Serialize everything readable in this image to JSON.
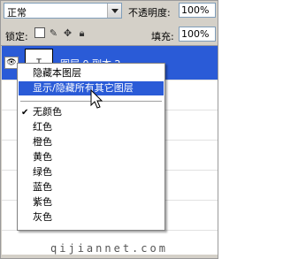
{
  "toolbar": {
    "blend_mode": "正常",
    "opacity_label": "不透明度:",
    "opacity_value": "100%",
    "lock_label": "锁定:",
    "fill_label": "填充:",
    "fill_value": "100%"
  },
  "layer": {
    "name": "图层 0 副本 2",
    "thumb_label": "T"
  },
  "menu": {
    "items": [
      {
        "label": "隐藏本图层"
      },
      {
        "label": "显示/隐藏所有其它图层",
        "highlighted": true
      },
      {
        "label": "无颜色",
        "checked": true
      },
      {
        "label": "红色"
      },
      {
        "label": "橙色"
      },
      {
        "label": "黄色"
      },
      {
        "label": "绿色"
      },
      {
        "label": "蓝色"
      },
      {
        "label": "紫色"
      },
      {
        "label": "灰色"
      }
    ]
  },
  "watermark": "qijiannet.com",
  "colors": {
    "selection": "#2a5bd7",
    "panel": "#d4d0c8"
  }
}
